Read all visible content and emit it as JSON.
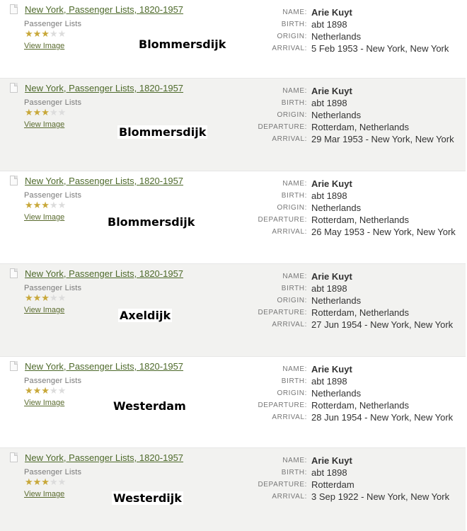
{
  "records": [
    {
      "title": "New York, Passenger Lists, 1820-1957",
      "collection": "Passenger Lists",
      "rating": "★★★",
      "rating_empty": "★★",
      "view_image": "View Image",
      "ship_note": "Blommersdijk",
      "fields": [
        {
          "label": "NAME:",
          "value": "Arie Kuyt"
        },
        {
          "label": "BIRTH:",
          "value": "abt 1898"
        },
        {
          "label": "ORIGIN:",
          "value": "Netherlands"
        },
        {
          "label": "ARRIVAL:",
          "value": "5 Feb 1953 - New York, New York"
        }
      ]
    },
    {
      "title": "New York, Passenger Lists, 1820-1957",
      "collection": "Passenger Lists",
      "rating": "★★★",
      "rating_empty": "★★",
      "view_image": "View Image",
      "ship_note": "Blommersdijk",
      "fields": [
        {
          "label": "NAME:",
          "value": "Arie Kuyt"
        },
        {
          "label": "BIRTH:",
          "value": "abt 1898"
        },
        {
          "label": "ORIGIN:",
          "value": "Netherlands"
        },
        {
          "label": "DEPARTURE:",
          "value": "Rotterdam, Netherlands"
        },
        {
          "label": "ARRIVAL:",
          "value": "29 Mar 1953 - New York, New York"
        }
      ]
    },
    {
      "title": "New York, Passenger Lists, 1820-1957",
      "collection": "Passenger Lists",
      "rating": "★★★",
      "rating_empty": "★★",
      "view_image": "View Image",
      "ship_note": "Blommersdijk",
      "fields": [
        {
          "label": "NAME:",
          "value": "Arie Kuyt"
        },
        {
          "label": "BIRTH:",
          "value": "abt 1898"
        },
        {
          "label": "ORIGIN:",
          "value": "Netherlands"
        },
        {
          "label": "DEPARTURE:",
          "value": "Rotterdam, Netherlands"
        },
        {
          "label": "ARRIVAL:",
          "value": "26 May 1953 - New York, New York"
        }
      ]
    },
    {
      "title": "New York, Passenger Lists, 1820-1957",
      "collection": "Passenger Lists",
      "rating": "★★★",
      "rating_empty": "★★",
      "view_image": "View Image",
      "ship_note": "Axeldijk",
      "fields": [
        {
          "label": "NAME:",
          "value": "Arie Kuyt"
        },
        {
          "label": "BIRTH:",
          "value": "abt 1898"
        },
        {
          "label": "ORIGIN:",
          "value": "Netherlands"
        },
        {
          "label": "DEPARTURE:",
          "value": "Rotterdam, Netherlands"
        },
        {
          "label": "ARRIVAL:",
          "value": "27 Jun 1954 - New York, New York"
        }
      ]
    },
    {
      "title": "New York, Passenger Lists, 1820-1957",
      "collection": "Passenger Lists",
      "rating": "★★★",
      "rating_empty": "★★",
      "view_image": "View Image",
      "ship_note": "Westerdam",
      "fields": [
        {
          "label": "NAME:",
          "value": "Arie Kuyt"
        },
        {
          "label": "BIRTH:",
          "value": "abt 1898"
        },
        {
          "label": "ORIGIN:",
          "value": "Netherlands"
        },
        {
          "label": "DEPARTURE:",
          "value": "Rotterdam, Netherlands"
        },
        {
          "label": "ARRIVAL:",
          "value": "28 Jun 1954 - New York, New York"
        }
      ]
    },
    {
      "title": "New York, Passenger Lists, 1820-1957",
      "collection": "Passenger Lists",
      "rating": "★★★",
      "rating_empty": "★★",
      "view_image": "View Image",
      "ship_note": "Westerdijk",
      "fields": [
        {
          "label": "NAME:",
          "value": "Arie Kuyt"
        },
        {
          "label": "BIRTH:",
          "value": "abt 1898"
        },
        {
          "label": "DEPARTURE:",
          "value": "Rotterdam"
        },
        {
          "label": "ARRIVAL:",
          "value": "3 Sep 1922 - New York, New York"
        }
      ]
    }
  ]
}
